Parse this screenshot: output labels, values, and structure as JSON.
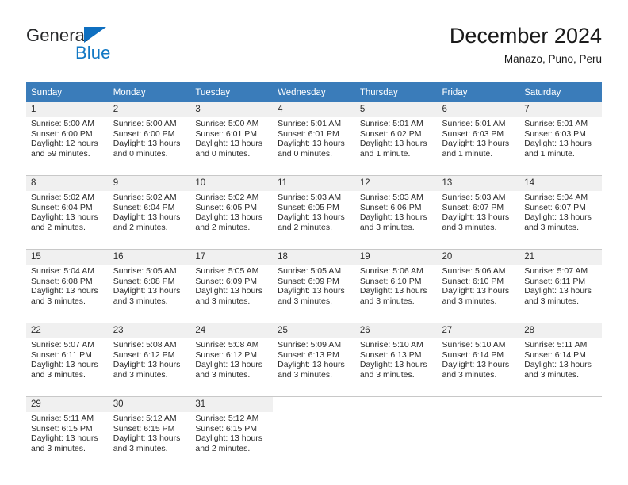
{
  "logo": {
    "word_one": "General",
    "word_two": "Blue",
    "triangle_icon": "triangle-icon",
    "brand_blue": "#1278c4",
    "brand_dark": "#28292b"
  },
  "header": {
    "title": "December 2024",
    "subtitle": "Manazo, Puno, Peru"
  },
  "calendar": {
    "header_background": "#3a7cba",
    "daynum_background": "#f0f0f0",
    "weekdays": [
      "Sunday",
      "Monday",
      "Tuesday",
      "Wednesday",
      "Thursday",
      "Friday",
      "Saturday"
    ],
    "weeks": [
      [
        {
          "day": "1",
          "sunrise": "Sunrise: 5:00 AM",
          "sunset": "Sunset: 6:00 PM",
          "daylight_line1": "Daylight: 12 hours",
          "daylight_line2": "and 59 minutes."
        },
        {
          "day": "2",
          "sunrise": "Sunrise: 5:00 AM",
          "sunset": "Sunset: 6:00 PM",
          "daylight_line1": "Daylight: 13 hours",
          "daylight_line2": "and 0 minutes."
        },
        {
          "day": "3",
          "sunrise": "Sunrise: 5:00 AM",
          "sunset": "Sunset: 6:01 PM",
          "daylight_line1": "Daylight: 13 hours",
          "daylight_line2": "and 0 minutes."
        },
        {
          "day": "4",
          "sunrise": "Sunrise: 5:01 AM",
          "sunset": "Sunset: 6:01 PM",
          "daylight_line1": "Daylight: 13 hours",
          "daylight_line2": "and 0 minutes."
        },
        {
          "day": "5",
          "sunrise": "Sunrise: 5:01 AM",
          "sunset": "Sunset: 6:02 PM",
          "daylight_line1": "Daylight: 13 hours",
          "daylight_line2": "and 1 minute."
        },
        {
          "day": "6",
          "sunrise": "Sunrise: 5:01 AM",
          "sunset": "Sunset: 6:03 PM",
          "daylight_line1": "Daylight: 13 hours",
          "daylight_line2": "and 1 minute."
        },
        {
          "day": "7",
          "sunrise": "Sunrise: 5:01 AM",
          "sunset": "Sunset: 6:03 PM",
          "daylight_line1": "Daylight: 13 hours",
          "daylight_line2": "and 1 minute."
        }
      ],
      [
        {
          "day": "8",
          "sunrise": "Sunrise: 5:02 AM",
          "sunset": "Sunset: 6:04 PM",
          "daylight_line1": "Daylight: 13 hours",
          "daylight_line2": "and 2 minutes."
        },
        {
          "day": "9",
          "sunrise": "Sunrise: 5:02 AM",
          "sunset": "Sunset: 6:04 PM",
          "daylight_line1": "Daylight: 13 hours",
          "daylight_line2": "and 2 minutes."
        },
        {
          "day": "10",
          "sunrise": "Sunrise: 5:02 AM",
          "sunset": "Sunset: 6:05 PM",
          "daylight_line1": "Daylight: 13 hours",
          "daylight_line2": "and 2 minutes."
        },
        {
          "day": "11",
          "sunrise": "Sunrise: 5:03 AM",
          "sunset": "Sunset: 6:05 PM",
          "daylight_line1": "Daylight: 13 hours",
          "daylight_line2": "and 2 minutes."
        },
        {
          "day": "12",
          "sunrise": "Sunrise: 5:03 AM",
          "sunset": "Sunset: 6:06 PM",
          "daylight_line1": "Daylight: 13 hours",
          "daylight_line2": "and 3 minutes."
        },
        {
          "day": "13",
          "sunrise": "Sunrise: 5:03 AM",
          "sunset": "Sunset: 6:07 PM",
          "daylight_line1": "Daylight: 13 hours",
          "daylight_line2": "and 3 minutes."
        },
        {
          "day": "14",
          "sunrise": "Sunrise: 5:04 AM",
          "sunset": "Sunset: 6:07 PM",
          "daylight_line1": "Daylight: 13 hours",
          "daylight_line2": "and 3 minutes."
        }
      ],
      [
        {
          "day": "15",
          "sunrise": "Sunrise: 5:04 AM",
          "sunset": "Sunset: 6:08 PM",
          "daylight_line1": "Daylight: 13 hours",
          "daylight_line2": "and 3 minutes."
        },
        {
          "day": "16",
          "sunrise": "Sunrise: 5:05 AM",
          "sunset": "Sunset: 6:08 PM",
          "daylight_line1": "Daylight: 13 hours",
          "daylight_line2": "and 3 minutes."
        },
        {
          "day": "17",
          "sunrise": "Sunrise: 5:05 AM",
          "sunset": "Sunset: 6:09 PM",
          "daylight_line1": "Daylight: 13 hours",
          "daylight_line2": "and 3 minutes."
        },
        {
          "day": "18",
          "sunrise": "Sunrise: 5:05 AM",
          "sunset": "Sunset: 6:09 PM",
          "daylight_line1": "Daylight: 13 hours",
          "daylight_line2": "and 3 minutes."
        },
        {
          "day": "19",
          "sunrise": "Sunrise: 5:06 AM",
          "sunset": "Sunset: 6:10 PM",
          "daylight_line1": "Daylight: 13 hours",
          "daylight_line2": "and 3 minutes."
        },
        {
          "day": "20",
          "sunrise": "Sunrise: 5:06 AM",
          "sunset": "Sunset: 6:10 PM",
          "daylight_line1": "Daylight: 13 hours",
          "daylight_line2": "and 3 minutes."
        },
        {
          "day": "21",
          "sunrise": "Sunrise: 5:07 AM",
          "sunset": "Sunset: 6:11 PM",
          "daylight_line1": "Daylight: 13 hours",
          "daylight_line2": "and 3 minutes."
        }
      ],
      [
        {
          "day": "22",
          "sunrise": "Sunrise: 5:07 AM",
          "sunset": "Sunset: 6:11 PM",
          "daylight_line1": "Daylight: 13 hours",
          "daylight_line2": "and 3 minutes."
        },
        {
          "day": "23",
          "sunrise": "Sunrise: 5:08 AM",
          "sunset": "Sunset: 6:12 PM",
          "daylight_line1": "Daylight: 13 hours",
          "daylight_line2": "and 3 minutes."
        },
        {
          "day": "24",
          "sunrise": "Sunrise: 5:08 AM",
          "sunset": "Sunset: 6:12 PM",
          "daylight_line1": "Daylight: 13 hours",
          "daylight_line2": "and 3 minutes."
        },
        {
          "day": "25",
          "sunrise": "Sunrise: 5:09 AM",
          "sunset": "Sunset: 6:13 PM",
          "daylight_line1": "Daylight: 13 hours",
          "daylight_line2": "and 3 minutes."
        },
        {
          "day": "26",
          "sunrise": "Sunrise: 5:10 AM",
          "sunset": "Sunset: 6:13 PM",
          "daylight_line1": "Daylight: 13 hours",
          "daylight_line2": "and 3 minutes."
        },
        {
          "day": "27",
          "sunrise": "Sunrise: 5:10 AM",
          "sunset": "Sunset: 6:14 PM",
          "daylight_line1": "Daylight: 13 hours",
          "daylight_line2": "and 3 minutes."
        },
        {
          "day": "28",
          "sunrise": "Sunrise: 5:11 AM",
          "sunset": "Sunset: 6:14 PM",
          "daylight_line1": "Daylight: 13 hours",
          "daylight_line2": "and 3 minutes."
        }
      ],
      [
        {
          "day": "29",
          "sunrise": "Sunrise: 5:11 AM",
          "sunset": "Sunset: 6:15 PM",
          "daylight_line1": "Daylight: 13 hours",
          "daylight_line2": "and 3 minutes."
        },
        {
          "day": "30",
          "sunrise": "Sunrise: 5:12 AM",
          "sunset": "Sunset: 6:15 PM",
          "daylight_line1": "Daylight: 13 hours",
          "daylight_line2": "and 3 minutes."
        },
        {
          "day": "31",
          "sunrise": "Sunrise: 5:12 AM",
          "sunset": "Sunset: 6:15 PM",
          "daylight_line1": "Daylight: 13 hours",
          "daylight_line2": "and 2 minutes."
        },
        {
          "day": "",
          "sunrise": "",
          "sunset": "",
          "daylight_line1": "",
          "daylight_line2": ""
        },
        {
          "day": "",
          "sunrise": "",
          "sunset": "",
          "daylight_line1": "",
          "daylight_line2": ""
        },
        {
          "day": "",
          "sunrise": "",
          "sunset": "",
          "daylight_line1": "",
          "daylight_line2": ""
        },
        {
          "day": "",
          "sunrise": "",
          "sunset": "",
          "daylight_line1": "",
          "daylight_line2": ""
        }
      ]
    ]
  }
}
